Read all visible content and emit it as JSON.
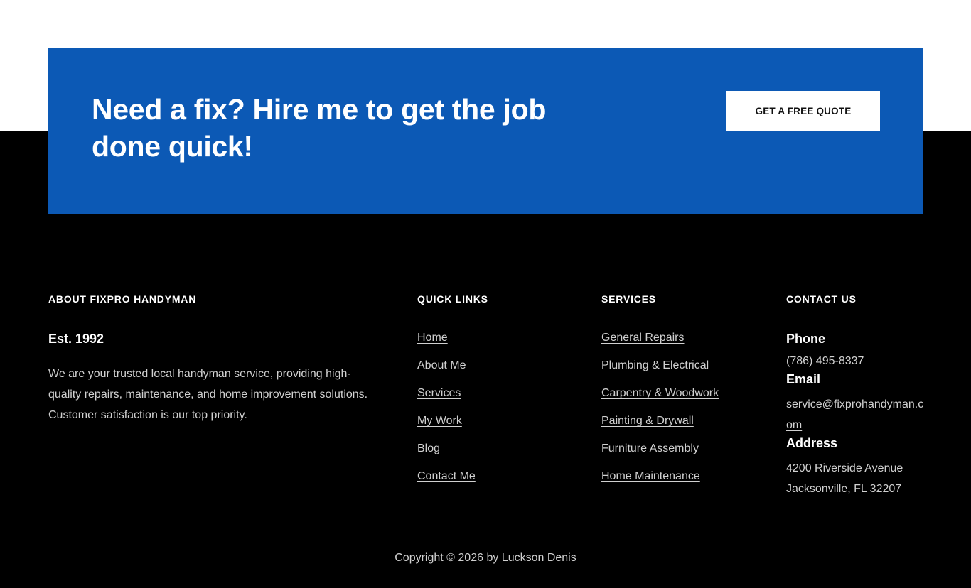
{
  "cta": {
    "headline": "Need a fix? Hire me to get the job done quick!",
    "button_label": "GET A FREE QUOTE",
    "band_color": "#0c59b5"
  },
  "about": {
    "heading": "ABOUT FIXPRO HANDYMAN",
    "est": "Est. 1992",
    "text": "We are your trusted local handyman service, providing high-quality repairs, maintenance, and home improvement solutions. Customer satisfaction is our top priority."
  },
  "quick_links": {
    "heading": "QUICK LINKS",
    "items": [
      {
        "label": "Home"
      },
      {
        "label": "About Me"
      },
      {
        "label": "Services"
      },
      {
        "label": "My Work"
      },
      {
        "label": "Blog"
      },
      {
        "label": "Contact Me"
      }
    ]
  },
  "services": {
    "heading": "SERVICES",
    "items": [
      {
        "label": "General Repairs"
      },
      {
        "label": "Plumbing & Electrical"
      },
      {
        "label": "Carpentry & Woodwork"
      },
      {
        "label": "Painting & Drywall"
      },
      {
        "label": "Furniture Assembly"
      },
      {
        "label": "Home Maintenance"
      }
    ]
  },
  "contact": {
    "heading": "CONTACT US",
    "phone_label": "Phone",
    "phone": "(786) 495-8337",
    "email_label": "Email",
    "email": "service@fixprohandyman.com",
    "address_label": "Address",
    "address_line1": "4200 Riverside Avenue",
    "address_line2": "Jacksonville, FL 32207"
  },
  "footer": {
    "copyright": "Copyright © 2026 by Luckson Denis"
  }
}
